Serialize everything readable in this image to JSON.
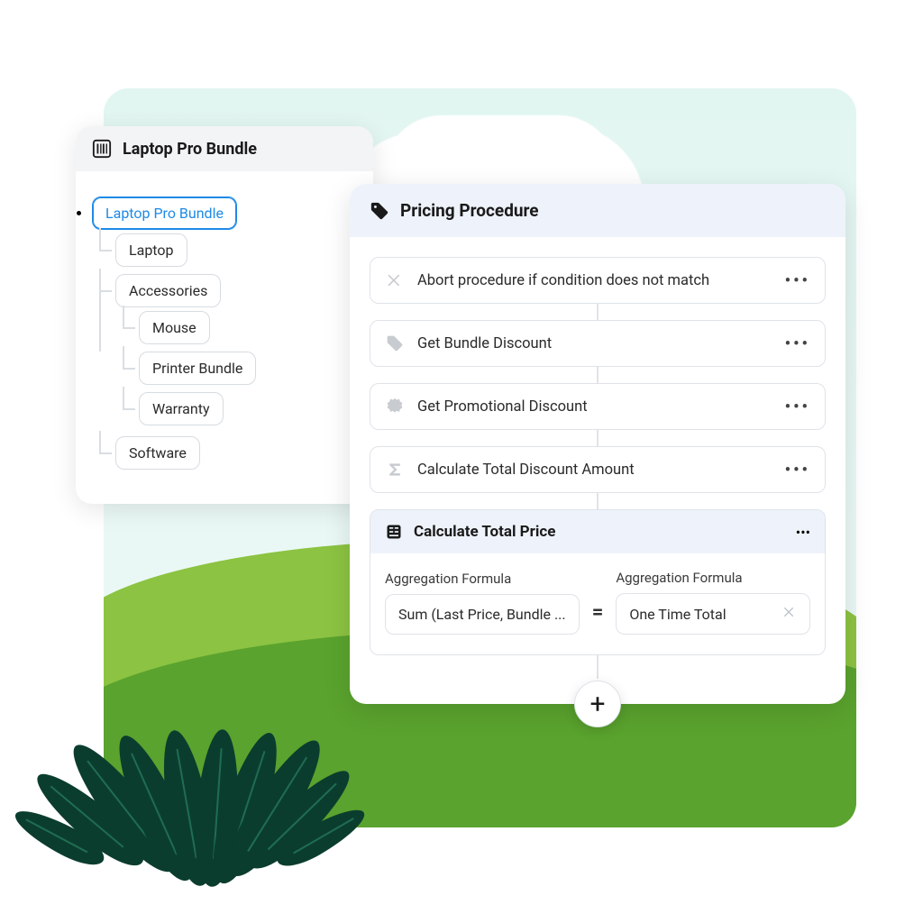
{
  "bundle": {
    "header_title": "Laptop Pro Bundle",
    "tree": {
      "root": "Laptop Pro Bundle",
      "children": [
        {
          "label": "Laptop"
        },
        {
          "label": "Accessories",
          "children": [
            {
              "label": "Mouse"
            },
            {
              "label": "Printer Bundle"
            },
            {
              "label": "Warranty"
            }
          ]
        },
        {
          "label": "Software"
        }
      ]
    }
  },
  "pricing": {
    "header_title": "Pricing Procedure",
    "steps": {
      "abort": {
        "label": "Abort procedure if condition does not match"
      },
      "bundle": {
        "label": "Get Bundle Discount"
      },
      "promo": {
        "label": "Get Promotional Discount"
      },
      "totalDisc": {
        "label": "Calculate Total Discount Amount"
      },
      "totalPrice": {
        "label": "Calculate Total Price",
        "left_label": "Aggregation Formula",
        "left_value": "Sum (Last Price, Bundle ...",
        "equals": "=",
        "right_label": "Aggregation Formula",
        "right_value": "One Time Total"
      }
    },
    "add_label": "+"
  },
  "icons": {
    "more": "•••"
  }
}
